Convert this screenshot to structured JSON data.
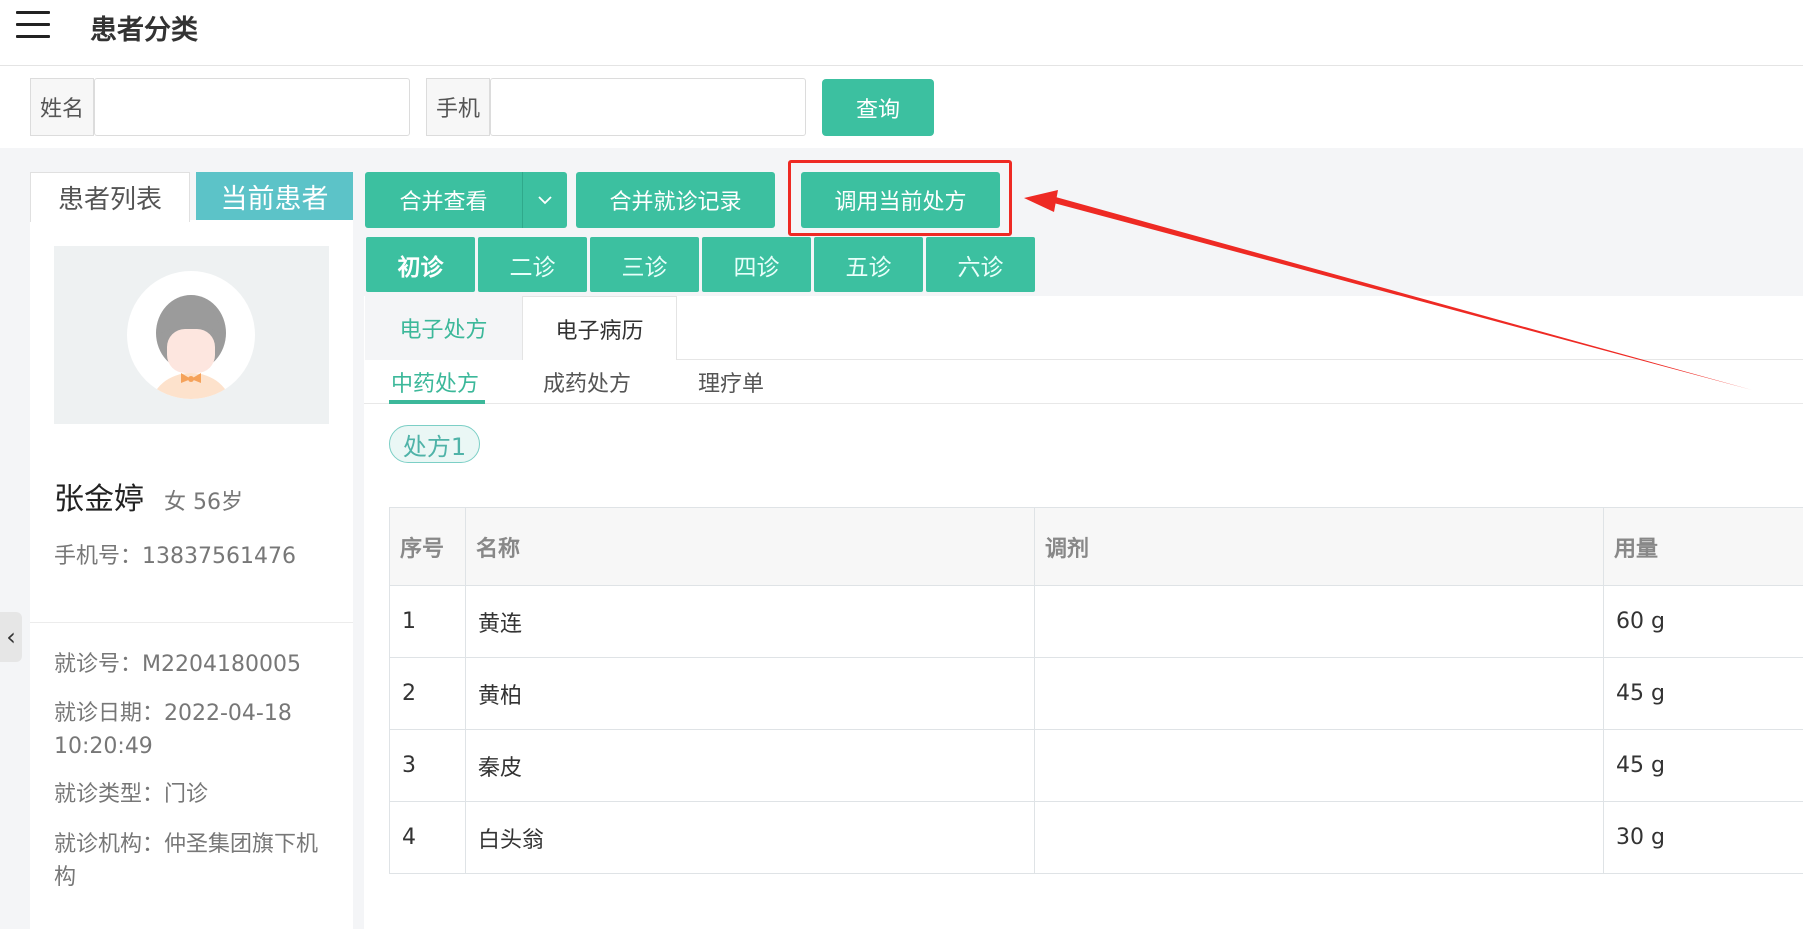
{
  "header": {
    "title": "患者分类"
  },
  "search": {
    "name_label": "姓名",
    "name_value": "",
    "phone_label": "手机",
    "phone_value": "",
    "query_label": "查询"
  },
  "left": {
    "tab_list": "患者列表",
    "tab_current": "当前患者",
    "patient": {
      "name": "张金婷",
      "gender_age": "女 56岁",
      "phone": "手机号：13837561476",
      "visit_no": "就诊号：M2204180005",
      "visit_date": "就诊日期：2022-04-18 10:20:49",
      "visit_type": "就诊类型：门诊",
      "institution": "就诊机构：仲圣集团旗下机构"
    }
  },
  "toolbar": {
    "merge_view": "合并查看",
    "merge_records": "合并就诊记录",
    "use_prescription": "调用当前处方"
  },
  "visits": [
    "初诊",
    "二诊",
    "三诊",
    "四诊",
    "五诊",
    "六诊"
  ],
  "doc_tabs": [
    "电子处方",
    "电子病历"
  ],
  "sub_tabs": [
    "中药处方",
    "成药处方",
    "理疗单"
  ],
  "prescription_tag": "处方1",
  "table": {
    "headers": [
      "序号",
      "名称",
      "调剂",
      "用量"
    ],
    "rows": [
      [
        "1",
        "黄连",
        "",
        "60 g"
      ],
      [
        "2",
        "黄柏",
        "",
        "45 g"
      ],
      [
        "3",
        "秦皮",
        "",
        "45 g"
      ],
      [
        "4",
        "白头翁",
        "",
        "30 g"
      ]
    ]
  },
  "colors": {
    "accent": "#3cc0a0",
    "current_tab": "#5cc3c8",
    "annotation": "#ee2a24"
  }
}
